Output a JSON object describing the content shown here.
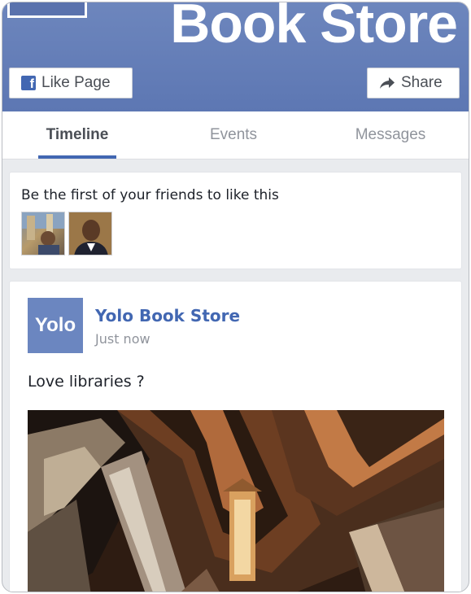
{
  "cover": {
    "title": "Book Store"
  },
  "actions": {
    "like_label": "Like Page",
    "share_label": "Share"
  },
  "tabs": [
    {
      "label": "Timeline",
      "active": true
    },
    {
      "label": "Events",
      "active": false
    },
    {
      "label": "Messages",
      "active": false
    }
  ],
  "friends": {
    "text": "Be the first of your friends to like this"
  },
  "post": {
    "page_logo_text": "Yolo",
    "page_name": "Yolo Book Store",
    "time": "Just now",
    "text": "Love libraries ?"
  },
  "colors": {
    "brand": "#4267b2",
    "cover": "#6580b9"
  },
  "icons": {
    "like": "facebook-f-icon",
    "share": "share-arrow-icon"
  }
}
